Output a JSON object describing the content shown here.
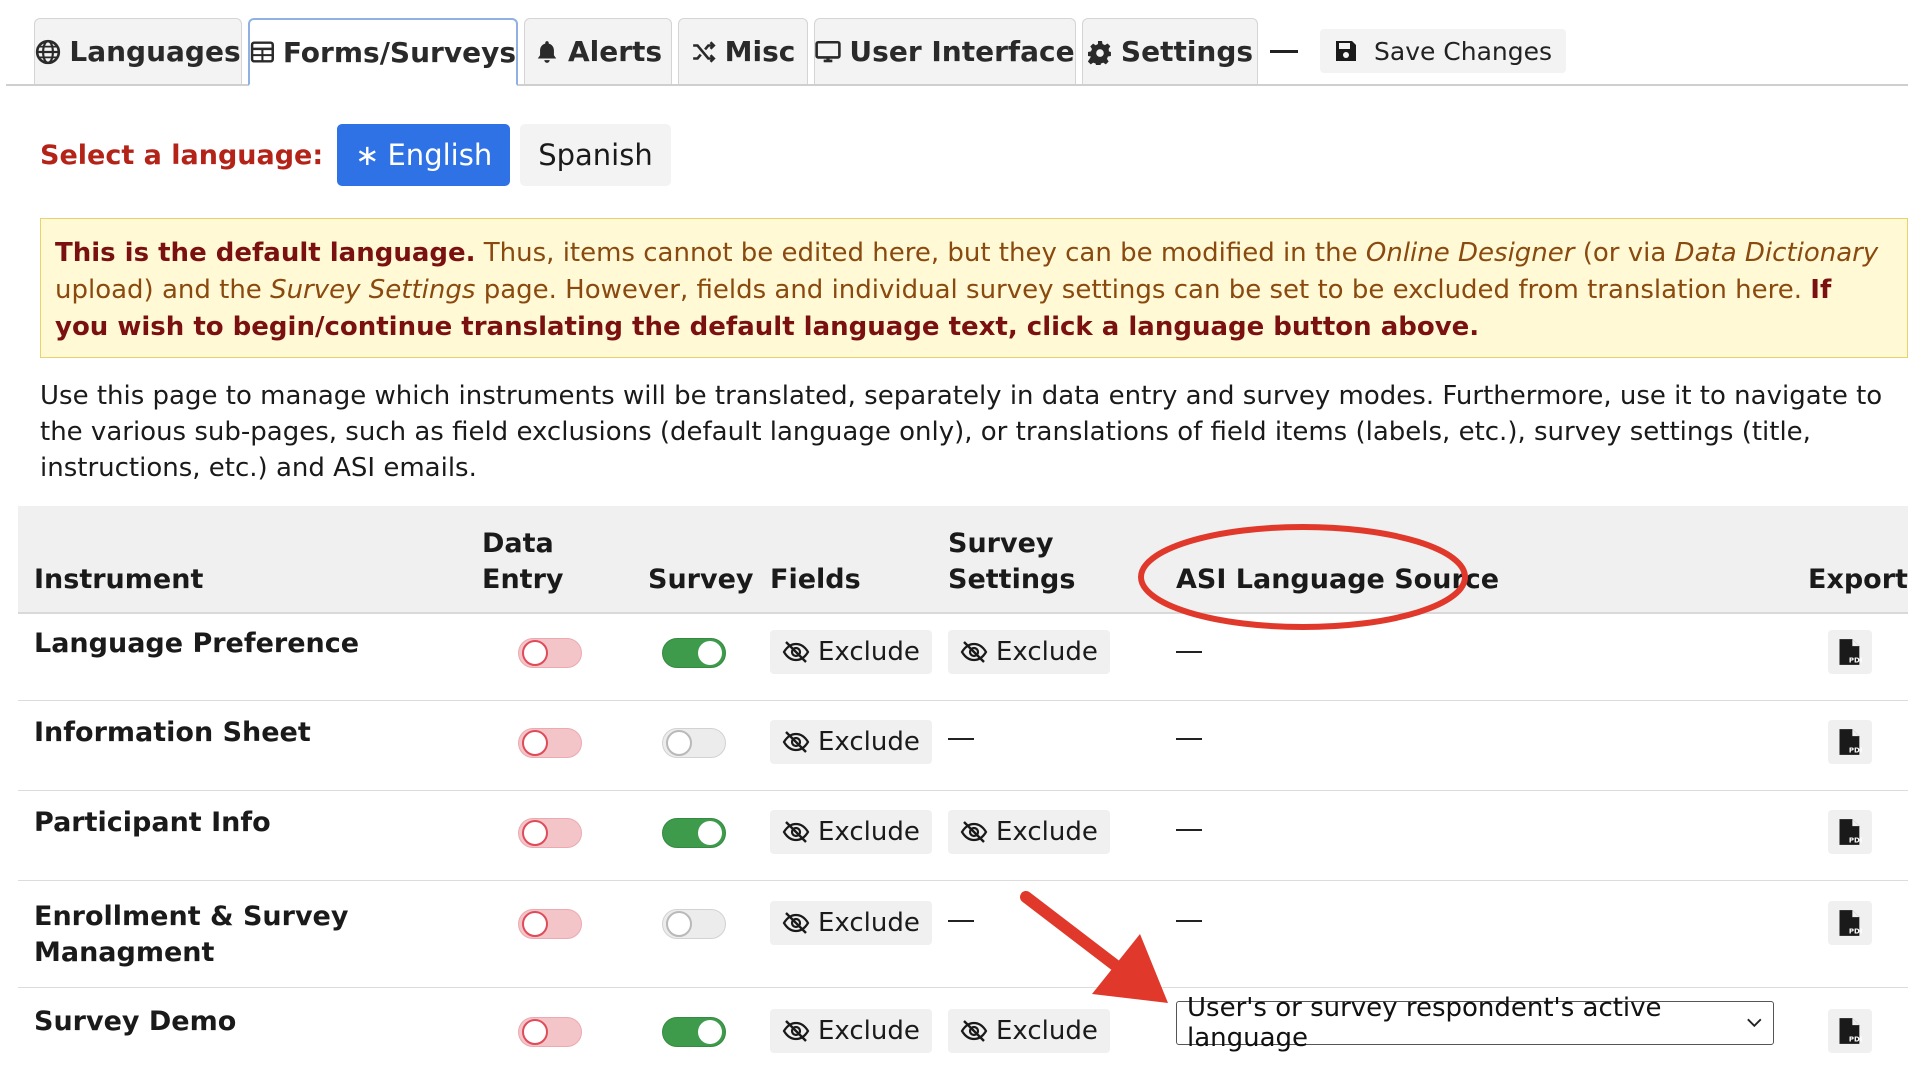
{
  "tabs": [
    {
      "label": "Languages",
      "icon": "globe-icon"
    },
    {
      "label": "Forms/Surveys",
      "icon": "table-icon",
      "active": true
    },
    {
      "label": "Alerts",
      "icon": "bell-icon"
    },
    {
      "label": "Misc",
      "icon": "shuffle-icon"
    },
    {
      "label": "User Interface",
      "icon": "monitor-icon"
    },
    {
      "label": "Settings",
      "icon": "gear-icon"
    }
  ],
  "save": {
    "label": "Save Changes",
    "icon": "floppy-icon"
  },
  "language_select": {
    "label": "Select a language:",
    "selected_prefix": "∗",
    "selected": "English",
    "other": "Spanish"
  },
  "notice": {
    "bold_start": "This is the default language.",
    "text1": " Thus, items cannot be edited here, but they can be modified in the ",
    "italic1": "Online Designer",
    "text2": " (or via ",
    "italic2": "Data Dictionary",
    "text3": " upload) and the ",
    "italic3": "Survey Settings",
    "text4": " page. However, fields and individual survey settings can be set to be excluded from translation here. ",
    "bold_end": "If you wish to begin/continue translating the default language text, click a language button above."
  },
  "description": "Use this page to manage which instruments will be translated, separately in data entry and survey modes. Furthermore, use it to navigate to the various sub-pages, such as field exclusions (default language only), or translations of field items (labels, etc.), survey settings (title, instructions, etc.) and ASI emails.",
  "table": {
    "headers": {
      "instrument": "Instrument",
      "data_entry_1": "Data",
      "data_entry_2": "Entry",
      "survey": "Survey",
      "fields": "Fields",
      "survey_settings_1": "Survey",
      "survey_settings_2": "Settings",
      "asi": "ASI Language Source",
      "export": "Export"
    },
    "exclude_label": "Exclude",
    "rows": [
      {
        "name_1": "Language Preference",
        "name_2": "",
        "data_entry": "off",
        "survey": "on"
      },
      {
        "name_1": "Information Sheet",
        "name_2": "",
        "data_entry": "off",
        "survey": "off"
      },
      {
        "name_1": "Participant Info",
        "name_2": "",
        "data_entry": "off",
        "survey": "on"
      },
      {
        "name_1": "Enrollment & Survey",
        "name_2": "Managment",
        "data_entry": "off",
        "survey": "off"
      },
      {
        "name_1": "Survey Demo",
        "name_2": "",
        "data_entry": "off",
        "survey": "on",
        "asi_value": "User's or survey respondent's active language"
      }
    ]
  },
  "annotation_color": "#e0392b"
}
